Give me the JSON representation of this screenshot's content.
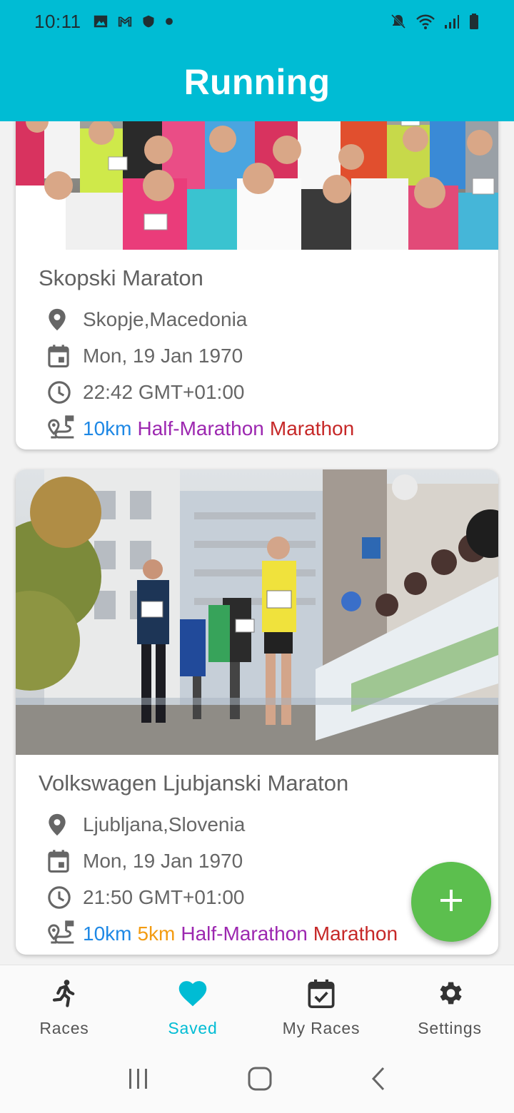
{
  "status_bar": {
    "time": "10:11",
    "left_icons": [
      "image-icon",
      "gmail-icon",
      "shield-icon",
      "dot-icon"
    ],
    "right_icons": [
      "mute-icon",
      "wifi-icon",
      "signal-icon",
      "battery-icon"
    ]
  },
  "app_bar": {
    "title": "Running"
  },
  "races": [
    {
      "title": "Skopski Maraton",
      "location": "Skopje,Macedonia",
      "date": "Mon, 19 Jan 1970",
      "time": "22:42 GMT+01:00",
      "distances": [
        "10km",
        "Half-Marathon",
        "Marathon"
      ]
    },
    {
      "title": "Volkswagen Ljubjanski Maraton",
      "location": "Ljubljana,Slovenia",
      "date": "Mon, 19 Jan 1970",
      "time": "21:50 GMT+01:00",
      "distances": [
        "10km",
        "5km",
        "Half-Marathon",
        "Marathon"
      ]
    }
  ],
  "fab": {
    "icon": "plus-icon"
  },
  "bottom_nav": {
    "items": [
      {
        "label": "Races",
        "icon": "runner-icon",
        "active": false
      },
      {
        "label": "Saved",
        "icon": "heart-icon",
        "active": true
      },
      {
        "label": "My Races",
        "icon": "calendar-check-icon",
        "active": false
      },
      {
        "label": "Settings",
        "icon": "gear-icon",
        "active": false
      }
    ]
  },
  "colors": {
    "primary": "#00bcd4",
    "fab": "#5cbf4e",
    "dist_10km": "#1e88e5",
    "dist_5km": "#f39c12",
    "dist_half": "#9c27b0",
    "dist_marathon": "#c62828"
  }
}
